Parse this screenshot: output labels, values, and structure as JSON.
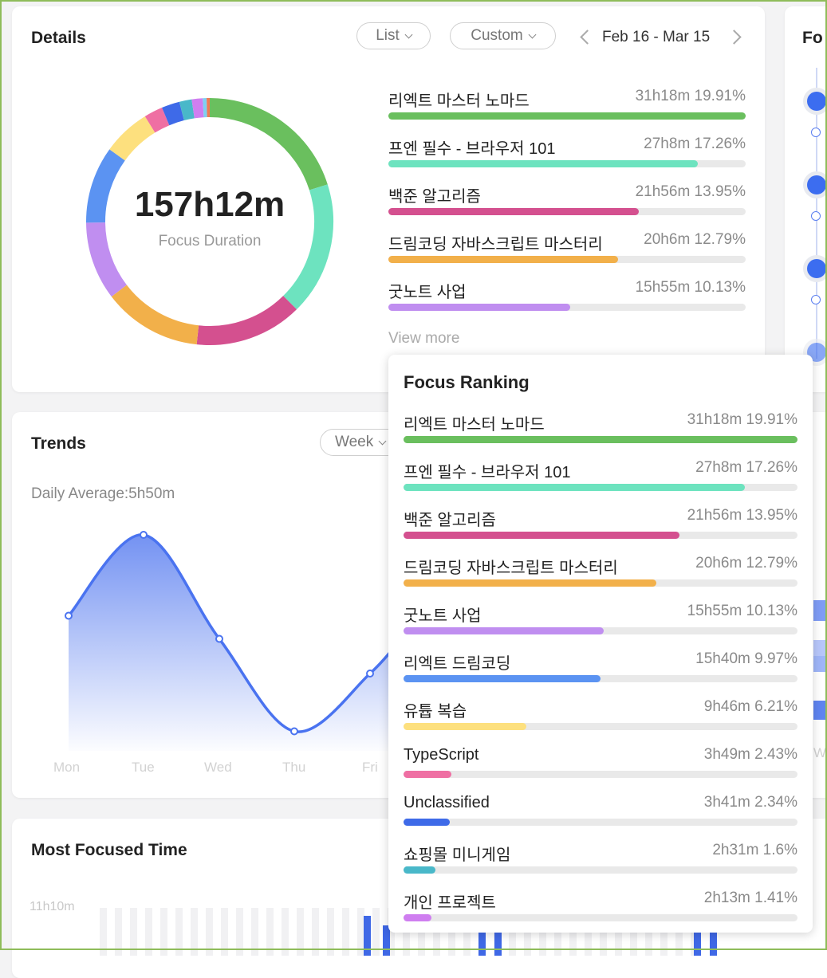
{
  "details": {
    "title": "Details",
    "view_mode": "List",
    "range_mode": "Custom",
    "date_range": "Feb 16 - Mar 15",
    "total_duration": "157h12m",
    "total_label": "Focus Duration",
    "view_more": "View more"
  },
  "right_card": {
    "title_partial": "Fo"
  },
  "trends": {
    "title": "Trends",
    "period": "Week",
    "daily_average": "Daily Average:5h50m",
    "days": [
      "Mon",
      "Tue",
      "Wed",
      "Thu",
      "Fri",
      "W"
    ]
  },
  "most_focused": {
    "title": "Most Focused Time",
    "y_tick": "11h10m"
  },
  "ranking_title": "Focus Ranking",
  "ranking": [
    {
      "name": "리엑트 마스터 노마드",
      "value": "31h18m 19.91%",
      "pct": 19.91,
      "color": "#6abf5e"
    },
    {
      "name": "프엔 필수 - 브라우저 101",
      "value": "27h8m 17.26%",
      "pct": 17.26,
      "color": "#6de3bf"
    },
    {
      "name": "백준 알고리즘",
      "value": "21h56m 13.95%",
      "pct": 13.95,
      "color": "#d4508f"
    },
    {
      "name": "드림코딩 자바스크립트 마스터리",
      "value": "20h6m 12.79%",
      "pct": 12.79,
      "color": "#f2b04a"
    },
    {
      "name": "굿노트 사업",
      "value": "15h55m 10.13%",
      "pct": 10.13,
      "color": "#c08ef0"
    },
    {
      "name": "리엑트 드림코딩",
      "value": "15h40m 9.97%",
      "pct": 9.97,
      "color": "#5b93f2"
    },
    {
      "name": "유튭 복습",
      "value": "9h46m 6.21%",
      "pct": 6.21,
      "color": "#fde07e"
    },
    {
      "name": "TypeScript",
      "value": "3h49m 2.43%",
      "pct": 2.43,
      "color": "#ef6fa3"
    },
    {
      "name": "Unclassified",
      "value": "3h41m 2.34%",
      "pct": 2.34,
      "color": "#3e6ae8"
    },
    {
      "name": "쇼핑몰 미니게임",
      "value": "2h31m 1.6%",
      "pct": 1.6,
      "color": "#49b8c9"
    },
    {
      "name": "개인 프로젝트",
      "value": "2h13m 1.41%",
      "pct": 1.41,
      "color": "#cf7ef0"
    }
  ],
  "donut_extra_slices": [
    {
      "pct": 0.5,
      "color": "#7ed0f0"
    },
    {
      "pct": 0.4,
      "color": "#f07a55"
    }
  ],
  "trend_values": {
    "Mon": 0.55,
    "Tue": 0.9,
    "Wed": 0.45,
    "Thu": 0.05,
    "Fri": 0.3
  },
  "colors": {
    "accent": "#3c6df0",
    "trend_line": "#4a73f0"
  }
}
